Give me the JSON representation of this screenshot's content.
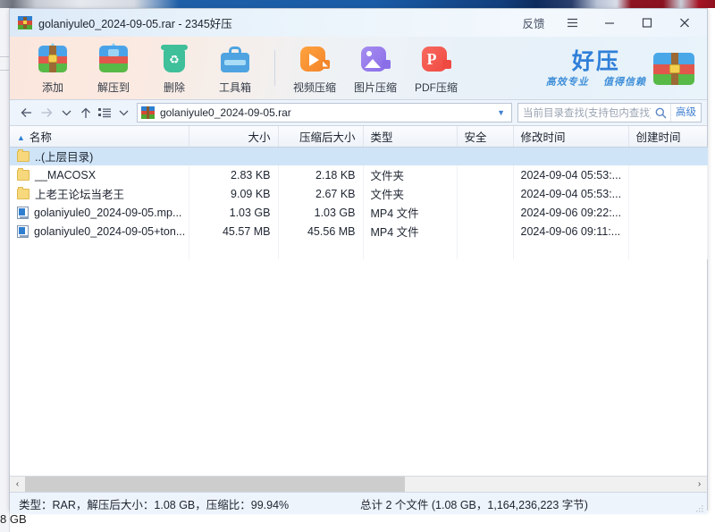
{
  "window": {
    "title": "golaniyule0_2024-09-05.rar - 2345好压",
    "titlebar_buttons": {
      "feedback": "反馈",
      "menu_icon": "hamburger-menu-icon",
      "minimize_icon": "minimize-icon",
      "maximize_icon": "maximize-icon",
      "close_icon": "close-icon"
    }
  },
  "toolbar": {
    "items": [
      {
        "label": "添加",
        "icon": "add-archive-icon"
      },
      {
        "label": "解压到",
        "icon": "extract-to-icon"
      },
      {
        "label": "删除",
        "icon": "delete-trash-icon"
      },
      {
        "label": "工具箱",
        "icon": "toolbox-icon"
      },
      {
        "label": "视频压缩",
        "icon": "video-compress-icon"
      },
      {
        "label": "图片压缩",
        "icon": "image-compress-icon"
      },
      {
        "label": "PDF压缩",
        "icon": "pdf-compress-icon"
      }
    ],
    "brand": {
      "name": "好压",
      "slogan_left": "高效专业",
      "slogan_right": "值得信赖",
      "icon": "haozip-archive-icon",
      "color": "#2f7fd8"
    }
  },
  "addressbar": {
    "back_icon": "arrow-left-icon",
    "forward_icon": "arrow-right-icon",
    "history_icon": "chevron-down-icon",
    "up_icon": "arrow-up-icon",
    "view_icon": "list-view-icon",
    "view_caret_icon": "chevron-down-icon",
    "path": "golaniyule0_2024-09-05.rar",
    "path_icon": "rar-file-icon",
    "path_caret_icon": "chevron-down-icon",
    "search_placeholder": "当前目录查找(支持包内查找)",
    "search_value": "",
    "search_icon": "search-icon",
    "advanced_label": "高级"
  },
  "filelist": {
    "columns": [
      {
        "key": "name",
        "label": "名称",
        "align": "left",
        "sorted": true,
        "sort_icon": "sort-asc-icon"
      },
      {
        "key": "size",
        "label": "大小",
        "align": "right"
      },
      {
        "key": "packed",
        "label": "压缩后大小",
        "align": "right"
      },
      {
        "key": "type",
        "label": "类型",
        "align": "left"
      },
      {
        "key": "security",
        "label": "安全",
        "align": "left"
      },
      {
        "key": "modified",
        "label": "修改时间",
        "align": "left"
      },
      {
        "key": "created",
        "label": "创建时间",
        "align": "left"
      }
    ],
    "rows": [
      {
        "name": "..(上层目录)",
        "icon": "folder-icon",
        "size": "",
        "packed": "",
        "type": "",
        "security": "",
        "modified": "",
        "created": "",
        "selected": true
      },
      {
        "name": "__MACOSX",
        "icon": "folder-icon",
        "size": "2.83 KB",
        "packed": "2.18 KB",
        "type": "文件夹",
        "security": "",
        "modified": "2024-09-04 05:53:...",
        "created": "",
        "selected": false
      },
      {
        "name": "上老王论坛当老王",
        "icon": "folder-icon",
        "size": "9.09 KB",
        "packed": "2.67 KB",
        "type": "文件夹",
        "security": "",
        "modified": "2024-09-04 05:53:...",
        "created": "",
        "selected": false
      },
      {
        "name": "golaniyule0_2024-09-05.mp...",
        "icon": "mp4-file-icon",
        "size": "1.03 GB",
        "packed": "1.03 GB",
        "type": "MP4 文件",
        "security": "",
        "modified": "2024-09-06 09:22:...",
        "created": "",
        "selected": false
      },
      {
        "name": "golaniyule0_2024-09-05+ton...",
        "icon": "mp4-file-icon",
        "size": "45.57 MB",
        "packed": "45.56 MB",
        "type": "MP4 文件",
        "security": "",
        "modified": "2024-09-06 09:11:...",
        "created": "",
        "selected": false
      }
    ]
  },
  "hscrollbar": {
    "left_arrow": "‹",
    "right_arrow": "›"
  },
  "statusbar": {
    "left": "类型：RAR，解压后大小：1.08 GB，压缩比：99.94%",
    "right": "总计 2 个文件 (1.08 GB，1,164,236,223 字节)"
  },
  "background": {
    "bottom_text": "8 GB"
  }
}
